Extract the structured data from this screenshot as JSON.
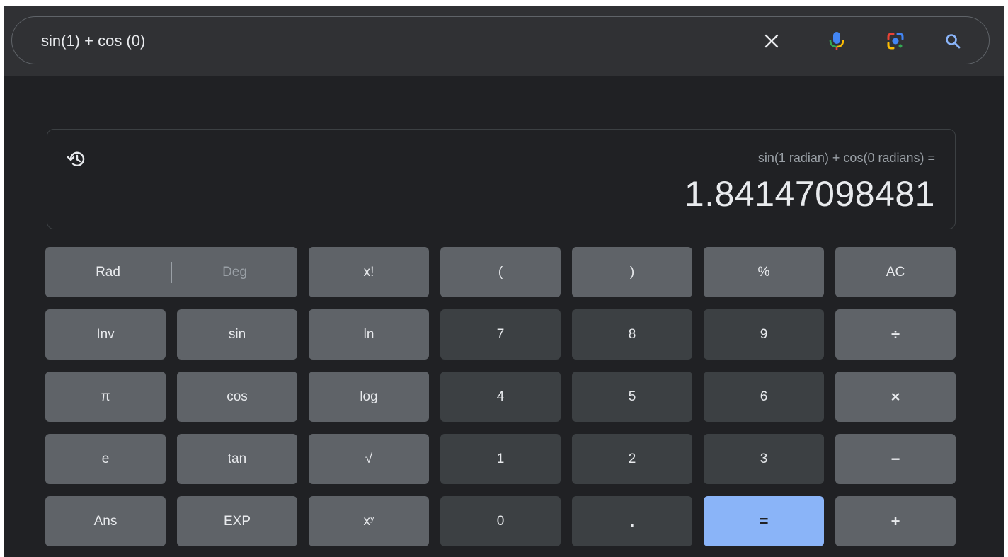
{
  "search": {
    "query": "sin(1) + cos (0)",
    "icons": [
      "close-icon",
      "mic-icon",
      "lens-icon",
      "search-icon"
    ]
  },
  "calculator": {
    "expression": "sin(1 radian) + cos(0 radians) =",
    "result": "1.84147098481",
    "mode": {
      "rad_label": "Rad",
      "deg_label": "Deg",
      "selected": "Rad"
    },
    "keys": {
      "fact": "x!",
      "lparen": "(",
      "rparen": ")",
      "percent": "%",
      "ac": "AC",
      "inv": "Inv",
      "sin": "sin",
      "ln": "ln",
      "seven": "7",
      "eight": "8",
      "nine": "9",
      "divide": "÷",
      "pi": "π",
      "cos": "cos",
      "log": "log",
      "four": "4",
      "five": "5",
      "six": "6",
      "multiply": "×",
      "e": "e",
      "tan": "tan",
      "sqrt": "√",
      "one": "1",
      "two": "2",
      "three": "3",
      "minus": "−",
      "ans": "Ans",
      "exp": "EXP",
      "pow_base": "x",
      "pow_exp": "y",
      "zero": "0",
      "dot": ".",
      "equals": "=",
      "plus": "+"
    },
    "colors": {
      "operator_key": "#5f6368",
      "digit_key": "#3c4043",
      "equals_key": "#8ab4f8",
      "background": "#202124"
    }
  }
}
